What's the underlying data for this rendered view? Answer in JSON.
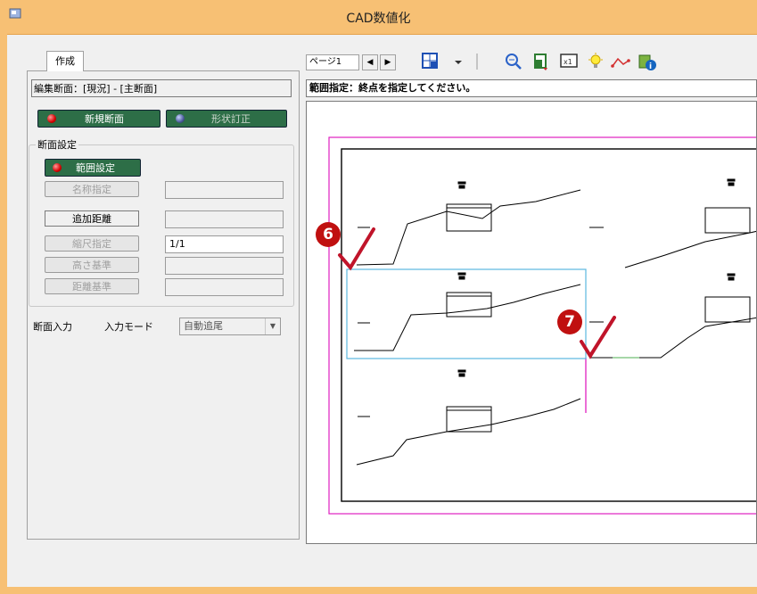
{
  "window": {
    "title": "CAD数値化"
  },
  "left": {
    "tab_label": "作成",
    "edit_section": "編集断面：[現況] - [主断面]",
    "new_section_button": "新規断面",
    "shape_correct_button": "形状訂正",
    "group_title": "断面設定",
    "range_button": "範囲設定",
    "name_button": "名称指定",
    "name_value": "",
    "add_distance_button": "追加距離",
    "add_distance_value": "",
    "scale_button": "縮尺指定",
    "scale_value": "1/1",
    "height_button": "高さ基準",
    "height_value": "",
    "distance_button": "距離基準",
    "distance_value": "",
    "input_label": "断面入力",
    "mode_label": "入力モード",
    "mode_value": "自動追尾"
  },
  "toolbar": {
    "page_label": "ページ1",
    "prev": "◀",
    "next": "▶",
    "icons": [
      "page-layout-icon",
      "dropdown-icon",
      "zoom-icon",
      "page-select-icon",
      "fit-icon",
      "bulb-icon",
      "path-icon",
      "info-icon"
    ]
  },
  "status": {
    "message": "範囲指定：終点を指定してください。"
  },
  "markers": {
    "six": "6",
    "seven": "7"
  },
  "colors": {
    "titlebar": "#f7c074",
    "button_green": "#2d6e47",
    "marker_red": "#c01010",
    "check": "#c0142a",
    "magenta": "#e020c0",
    "cyan": "#5ab8e0"
  }
}
